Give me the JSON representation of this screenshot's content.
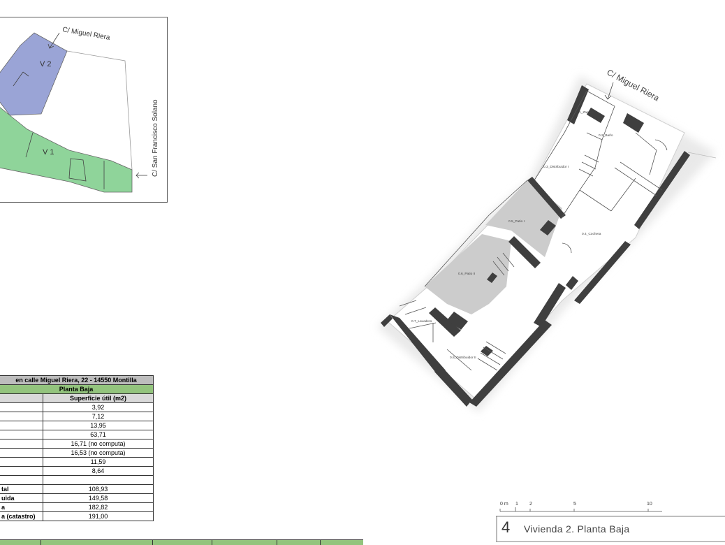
{
  "site_plan": {
    "street_top": "C/ Miguel Riera",
    "street_side": "C/ San Francisco Solano",
    "unit_v2": "V 2",
    "unit_v1": "V 1",
    "colors": {
      "v2": "#9aa4d6",
      "v1": "#8fd49a"
    }
  },
  "floor_plan": {
    "street_label": "C/ Miguel Riera",
    "rooms": [
      {
        "id": "zaguan",
        "label": "0.1_Zaguán"
      },
      {
        "id": "bano",
        "label": "0.2_Baño"
      },
      {
        "id": "distribuidor1",
        "label": "0.3_Distribuidor I"
      },
      {
        "id": "patio1",
        "label": "0.5_Patio I"
      },
      {
        "id": "cochera",
        "label": "0.4_Cochera"
      },
      {
        "id": "patio2",
        "label": "0.6_Patio II"
      },
      {
        "id": "lavadero",
        "label": "0.7_Lavadero"
      },
      {
        "id": "distribuidor2",
        "label": "0.8_Distribuidor II"
      }
    ]
  },
  "area_table": {
    "title": "en calle Miguel Riera, 22 - 14550 Montilla",
    "subtitle": "Planta Baja",
    "column_header": "Superficie útil (m2)",
    "rows": [
      {
        "label": "",
        "value": "3,92"
      },
      {
        "label": "",
        "value": "7,12"
      },
      {
        "label": "",
        "value": "13,95"
      },
      {
        "label": "",
        "value": "63,71"
      },
      {
        "label": "",
        "value": "16,71  (no computa)"
      },
      {
        "label": "",
        "value": "16,53  (no computa)"
      },
      {
        "label": "",
        "value": "11,59"
      },
      {
        "label": "",
        "value": "8,64"
      },
      {
        "label": "",
        "value": ""
      },
      {
        "label": "tal",
        "value": "108,93"
      },
      {
        "label": "uida",
        "value": "149,58"
      },
      {
        "label": "a",
        "value": "182,82"
      },
      {
        "label": "a (catastro)",
        "value": "191,00"
      }
    ]
  },
  "scale_bar": {
    "labels": [
      "0 m",
      "1",
      "2",
      "5",
      "10"
    ]
  },
  "title_block": {
    "number": "4",
    "title": "Vivienda 2. Planta Baja"
  }
}
